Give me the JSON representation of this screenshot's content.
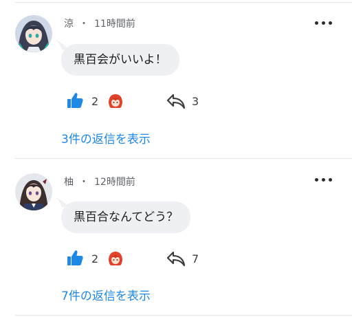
{
  "colors": {
    "link": "#1d88e6",
    "like": "#1d88e6",
    "bubble": "#eef0f3"
  },
  "comments": [
    {
      "author": "涼",
      "separator": "・",
      "time": "11時間前",
      "text": "黒百会がいいよ！",
      "likes": "2",
      "replies": "3",
      "view_replies": "3件の返信を表示",
      "avatar_icon": "anime-girl-teal-hair-avatar",
      "reactor_icon": "red-hair-character-reaction-icon"
    },
    {
      "author": "柚",
      "separator": "・",
      "time": "12時間前",
      "text": "黒百合なんてどう？",
      "likes": "2",
      "replies": "7",
      "view_replies": "7件の返信を表示",
      "avatar_icon": "anime-girl-dark-hair-avatar",
      "reactor_icon": "red-hair-character-reaction-icon"
    }
  ]
}
